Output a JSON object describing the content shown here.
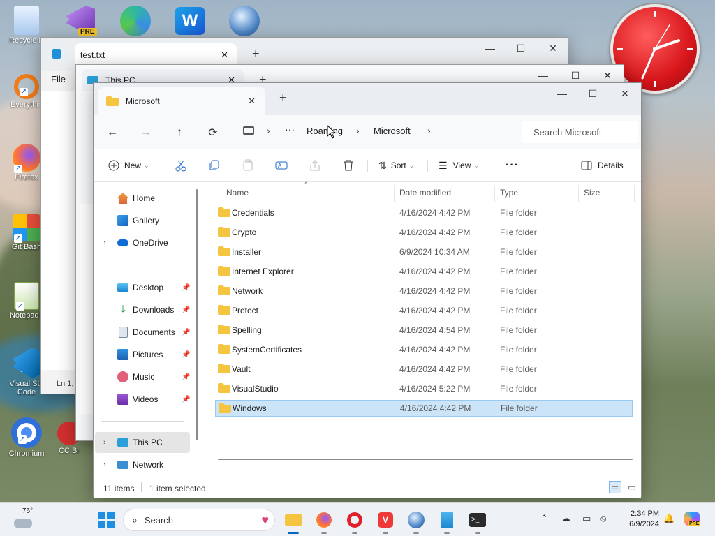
{
  "desktop": {
    "icons": [
      {
        "label": "Recycle B"
      },
      {
        "label": "Everythin"
      },
      {
        "label": "Firefox"
      },
      {
        "label": "Git Bash"
      },
      {
        "label": "Notepad+"
      },
      {
        "label": "Visual Stu Code"
      },
      {
        "label": "Chromium"
      },
      {
        "label": "CC Br"
      }
    ],
    "top_icons": [
      {
        "name": "visual-studio-preview",
        "badge": "PRE"
      },
      {
        "name": "edge"
      },
      {
        "name": "wps"
      },
      {
        "name": "ie"
      }
    ]
  },
  "notepad": {
    "tab_title": "test.txt",
    "menu_file": "File",
    "status": "Ln 1,"
  },
  "thispc_window": {
    "tab_title": "This PC"
  },
  "explorer": {
    "tab_title": "Microsoft",
    "breadcrumb": [
      "Roaming",
      "Microsoft"
    ],
    "search_placeholder": "Search Microsoft",
    "toolbar": {
      "new_label": "New",
      "sort_label": "Sort",
      "view_label": "View",
      "details_label": "Details"
    },
    "nav": {
      "home": "Home",
      "gallery": "Gallery",
      "onedrive": "OneDrive",
      "desktop": "Desktop",
      "downloads": "Downloads",
      "documents": "Documents",
      "pictures": "Pictures",
      "music": "Music",
      "videos": "Videos",
      "thispc": "This PC",
      "network": "Network"
    },
    "columns": {
      "name": "Name",
      "date": "Date modified",
      "type": "Type",
      "size": "Size"
    },
    "files": [
      {
        "name": "Credentials",
        "date": "4/16/2024 4:42 PM",
        "type": "File folder"
      },
      {
        "name": "Crypto",
        "date": "4/16/2024 4:42 PM",
        "type": "File folder"
      },
      {
        "name": "Installer",
        "date": "6/9/2024 10:34 AM",
        "type": "File folder"
      },
      {
        "name": "Internet Explorer",
        "date": "4/16/2024 4:42 PM",
        "type": "File folder"
      },
      {
        "name": "Network",
        "date": "4/16/2024 4:42 PM",
        "type": "File folder"
      },
      {
        "name": "Protect",
        "date": "4/16/2024 4:42 PM",
        "type": "File folder"
      },
      {
        "name": "Spelling",
        "date": "4/16/2024 4:54 PM",
        "type": "File folder"
      },
      {
        "name": "SystemCertificates",
        "date": "4/16/2024 4:42 PM",
        "type": "File folder"
      },
      {
        "name": "Vault",
        "date": "4/16/2024 4:42 PM",
        "type": "File folder"
      },
      {
        "name": "VisualStudio",
        "date": "4/16/2024 5:22 PM",
        "type": "File folder"
      },
      {
        "name": "Windows",
        "date": "4/16/2024 4:42 PM",
        "type": "File folder",
        "selected": true
      }
    ],
    "status": {
      "count": "11 items",
      "selection": "1 item selected"
    }
  },
  "taskbar": {
    "weather": "76°",
    "search_label": "Search",
    "time": "2:34 PM",
    "date": "6/9/2024",
    "copilot_badge": "PRE"
  },
  "colors": {
    "folder": "#f5c542",
    "selection": "#cce4f7",
    "accent": "#0067c0",
    "clock_face": "#d8161b"
  }
}
